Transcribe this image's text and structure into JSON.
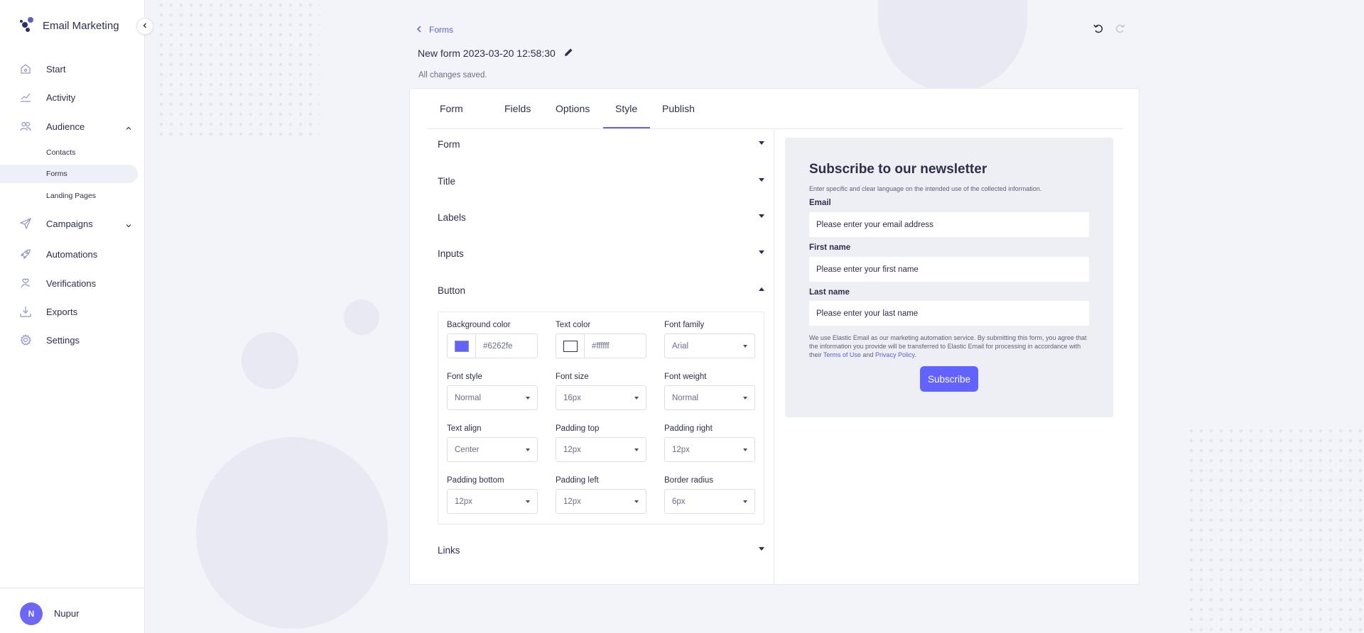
{
  "app": {
    "title": "Email Marketing"
  },
  "sidebar": {
    "items": [
      {
        "label": "Start",
        "icon": "home-icon"
      },
      {
        "label": "Activity",
        "icon": "activity-chart-icon"
      },
      {
        "label": "Audience",
        "icon": "users-icon"
      },
      {
        "label": "Campaigns",
        "icon": "paper-plane-icon"
      },
      {
        "label": "Automations",
        "icon": "rocket-icon"
      },
      {
        "label": "Verifications",
        "icon": "verified-hand-icon"
      },
      {
        "label": "Exports",
        "icon": "download-icon"
      },
      {
        "label": "Settings",
        "icon": "gear-icon"
      }
    ],
    "audience_sub": [
      "Contacts",
      "Forms",
      "Landing Pages"
    ],
    "active_sub": "Forms"
  },
  "user": {
    "initial": "N",
    "name": "Nupur"
  },
  "header": {
    "back_label": "Forms",
    "form_title": "New form 2023-03-20 12:58:30",
    "status": "All changes saved."
  },
  "tabs": [
    "Form",
    "Fields",
    "Options",
    "Style",
    "Publish"
  ],
  "active_tab": "Style",
  "sections": [
    "Form",
    "Title",
    "Labels",
    "Inputs",
    "Button",
    "Links"
  ],
  "button_settings": {
    "background_color": {
      "label": "Background color",
      "value": "#6262fe"
    },
    "text_color": {
      "label": "Text color",
      "value": "#ffffff"
    },
    "font_family": {
      "label": "Font family",
      "value": "Arial"
    },
    "font_style": {
      "label": "Font style",
      "value": "Normal"
    },
    "font_size": {
      "label": "Font size",
      "value": "16px"
    },
    "font_weight": {
      "label": "Font weight",
      "value": "Normal"
    },
    "text_align": {
      "label": "Text align",
      "value": "Center"
    },
    "padding_top": {
      "label": "Padding top",
      "value": "12px"
    },
    "padding_right": {
      "label": "Padding right",
      "value": "12px"
    },
    "padding_bottom": {
      "label": "Padding bottom",
      "value": "12px"
    },
    "padding_left": {
      "label": "Padding left",
      "value": "12px"
    },
    "border_radius": {
      "label": "Border radius",
      "value": "6px"
    }
  },
  "preview": {
    "title": "Subscribe to our newsletter",
    "description": "Enter specific and clear language on the intended use of the collected information.",
    "fields": [
      {
        "label": "Email",
        "placeholder": "Please enter your email address"
      },
      {
        "label": "First name",
        "placeholder": "Please enter your first name"
      },
      {
        "label": "Last name",
        "placeholder": "Please enter your last name"
      }
    ],
    "legal_text_1": "We use Elastic Email as our marketing automation service. By submitting this form, you agree that the information you provide will be transferred to Elastic Email for processing in accordance with their",
    "terms_link": "Terms of Use",
    "and_text": "and",
    "privacy_link": "Privacy Policy",
    "legal_end": ".",
    "button_label": "Subscribe"
  },
  "colors": {
    "accent": "#6462f5",
    "button": "#6262fe",
    "link": "#5a5fd6"
  }
}
